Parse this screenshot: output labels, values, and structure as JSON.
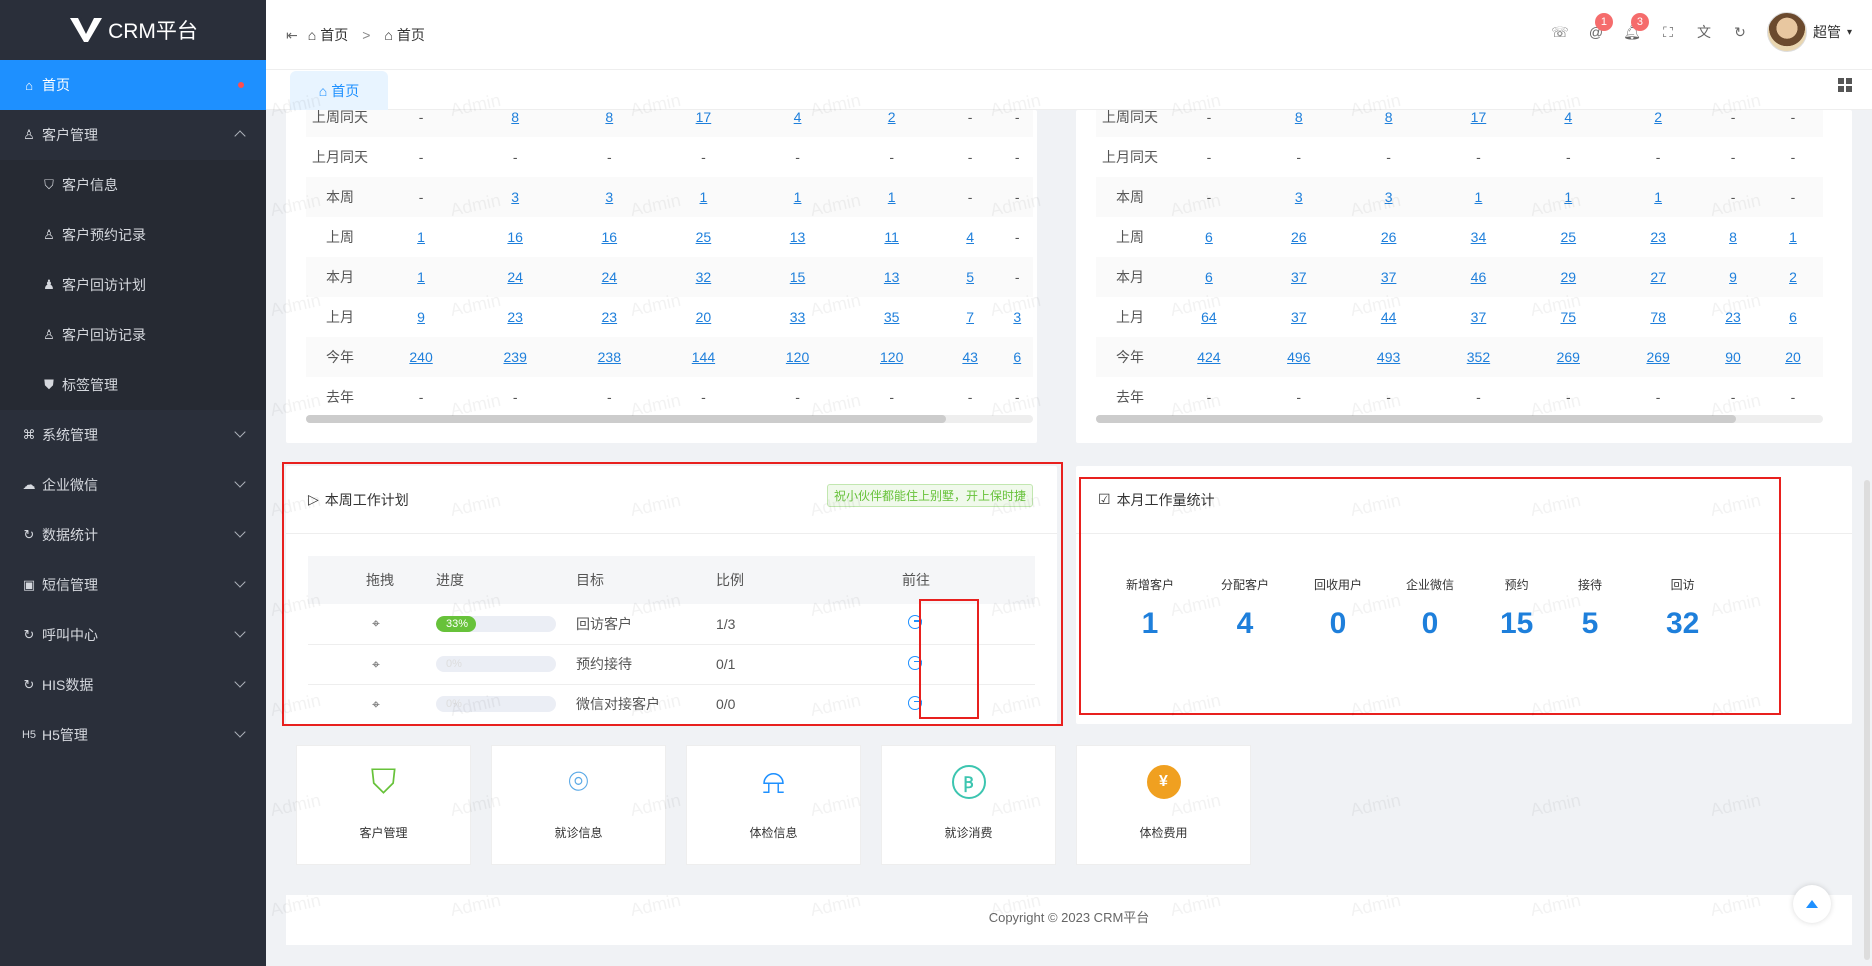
{
  "sidebar": {
    "logo_text": "CRM平台",
    "items": [
      {
        "label": "首页",
        "icon": "home-icon"
      },
      {
        "label": "客户管理",
        "icon": "user-icon"
      },
      {
        "label": "客户信息",
        "icon": "shield-user-icon"
      },
      {
        "label": "客户预约记录",
        "icon": "user-icon"
      },
      {
        "label": "客户回访计划",
        "icon": "user-filled-icon"
      },
      {
        "label": "客户回访记录",
        "icon": "user-icon"
      },
      {
        "label": "标签管理",
        "icon": "shield-check-icon"
      },
      {
        "label": "系统管理",
        "icon": "command-icon"
      },
      {
        "label": "企业微信",
        "icon": "wechat-icon"
      },
      {
        "label": "数据统计",
        "icon": "refresh-icon"
      },
      {
        "label": "短信管理",
        "icon": "message-icon"
      },
      {
        "label": "呼叫中心",
        "icon": "refresh-icon"
      },
      {
        "label": "HIS数据",
        "icon": "refresh-icon"
      },
      {
        "label": "H5管理",
        "icon": "h5-icon"
      }
    ]
  },
  "header": {
    "breadcrumb": [
      "首页",
      "首页"
    ],
    "badges": {
      "at": "1",
      "bell": "3"
    },
    "user_name": "超管"
  },
  "tabs": [
    {
      "label": "首页"
    }
  ],
  "left_table": {
    "rows": [
      {
        "label": "上周同天",
        "cells": [
          "-",
          "8",
          "8",
          "17",
          "4",
          "2",
          "-",
          "-"
        ]
      },
      {
        "label": "上月同天",
        "cells": [
          "-",
          "-",
          "-",
          "-",
          "-",
          "-",
          "-",
          "-"
        ]
      },
      {
        "label": "本周",
        "cells": [
          "-",
          "3",
          "3",
          "1",
          "1",
          "1",
          "-",
          "-"
        ]
      },
      {
        "label": "上周",
        "cells": [
          "1",
          "16",
          "16",
          "25",
          "13",
          "11",
          "4",
          "-"
        ]
      },
      {
        "label": "本月",
        "cells": [
          "1",
          "24",
          "24",
          "32",
          "15",
          "13",
          "5",
          "-"
        ]
      },
      {
        "label": "上月",
        "cells": [
          "9",
          "23",
          "23",
          "20",
          "33",
          "35",
          "7",
          "3"
        ]
      },
      {
        "label": "今年",
        "cells": [
          "240",
          "239",
          "238",
          "144",
          "120",
          "120",
          "43",
          "6"
        ]
      },
      {
        "label": "去年",
        "cells": [
          "-",
          "-",
          "-",
          "-",
          "-",
          "-",
          "-",
          "-"
        ]
      }
    ]
  },
  "right_table": {
    "rows": [
      {
        "label": "上周同天",
        "cells": [
          "-",
          "8",
          "8",
          "17",
          "4",
          "2",
          "-",
          "-"
        ]
      },
      {
        "label": "上月同天",
        "cells": [
          "-",
          "-",
          "-",
          "-",
          "-",
          "-",
          "-",
          "-"
        ]
      },
      {
        "label": "本周",
        "cells": [
          "-",
          "3",
          "3",
          "1",
          "1",
          "1",
          "-",
          "-"
        ]
      },
      {
        "label": "上周",
        "cells": [
          "6",
          "26",
          "26",
          "34",
          "25",
          "23",
          "8",
          "1"
        ]
      },
      {
        "label": "本月",
        "cells": [
          "6",
          "37",
          "37",
          "46",
          "29",
          "27",
          "9",
          "2"
        ]
      },
      {
        "label": "上月",
        "cells": [
          "64",
          "37",
          "44",
          "37",
          "75",
          "78",
          "23",
          "6"
        ]
      },
      {
        "label": "今年",
        "cells": [
          "424",
          "496",
          "493",
          "352",
          "269",
          "269",
          "90",
          "20"
        ]
      },
      {
        "label": "去年",
        "cells": [
          "-",
          "-",
          "-",
          "-",
          "-",
          "-",
          "-",
          "-"
        ]
      }
    ]
  },
  "weekly_plan": {
    "title": "本周工作计划",
    "tag": "祝小伙伴都能住上别墅，开上保时捷",
    "columns": [
      "拖拽",
      "进度",
      "目标",
      "比例",
      "前往"
    ],
    "rows": [
      {
        "progress_label": "33%",
        "progress": 0.33,
        "target": "回访客户",
        "ratio": "1/3"
      },
      {
        "progress_label": "0%",
        "progress": 0,
        "target": "预约接待",
        "ratio": "0/1"
      },
      {
        "progress_label": "0%",
        "progress": 0,
        "target": "微信对接客户",
        "ratio": "0/0"
      }
    ]
  },
  "monthly_stats": {
    "title": "本月工作量统计",
    "items": [
      {
        "label": "新增客户",
        "value": "1"
      },
      {
        "label": "分配客户",
        "value": "4"
      },
      {
        "label": "回收用户",
        "value": "0"
      },
      {
        "label": "企业微信",
        "value": "0"
      },
      {
        "label": "预约",
        "value": "15"
      },
      {
        "label": "接待",
        "value": "5"
      },
      {
        "label": "回访",
        "value": "32"
      }
    ]
  },
  "quick_links": [
    {
      "label": "客户管理",
      "icon": "shield-user-icon",
      "color": "#67c23a"
    },
    {
      "label": "就诊信息",
      "icon": "scan-user-icon",
      "color": "#5aa9e6"
    },
    {
      "label": "体检信息",
      "icon": "alarm-icon",
      "color": "#1e90ff"
    },
    {
      "label": "就诊消费",
      "icon": "coin-icon",
      "color": "#3cc5b0"
    },
    {
      "label": "体检费用",
      "icon": "yen-icon",
      "color": "#f0a020"
    }
  ],
  "footer": {
    "text": "Copyright © 2023 CRM平台"
  },
  "watermark": "Admin"
}
